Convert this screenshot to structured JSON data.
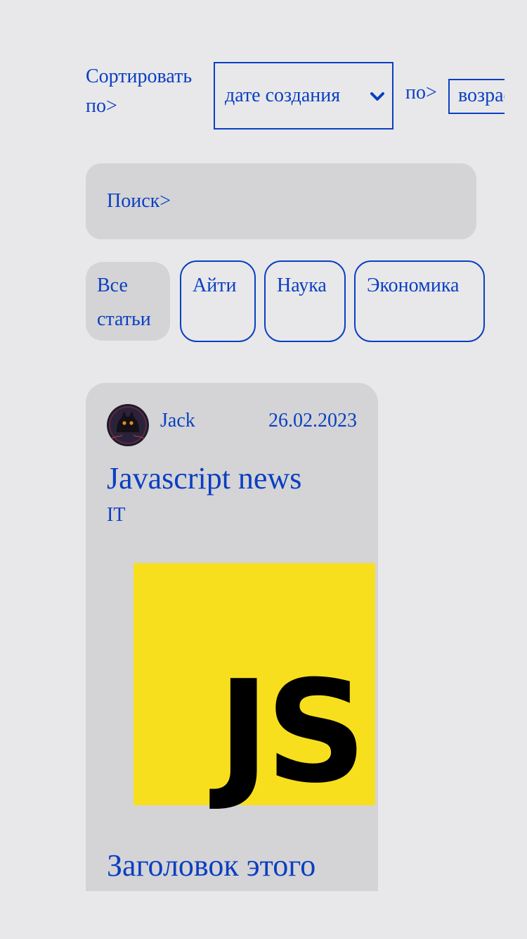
{
  "sort": {
    "label": "Сортировать по>",
    "field_value": "дате создания",
    "order_label": "по>",
    "order_value": "возрастанию"
  },
  "search": {
    "label": "Поиск>"
  },
  "categories": [
    {
      "label": "Все статьи",
      "active": true
    },
    {
      "label": "Айти",
      "active": false
    },
    {
      "label": "Наука",
      "active": false
    },
    {
      "label": "Экономика",
      "active": false
    }
  ],
  "articles": [
    {
      "author": "Jack",
      "date": "26.02.2023",
      "title": "Javascript news",
      "category": "IT",
      "image_text": "JS",
      "subtitle": "Заголовок этого"
    }
  ],
  "colors": {
    "accent": "#0b3fc1",
    "background": "#e8e8ea",
    "surface": "#d4d4d6",
    "js_yellow": "#f7df1e"
  }
}
